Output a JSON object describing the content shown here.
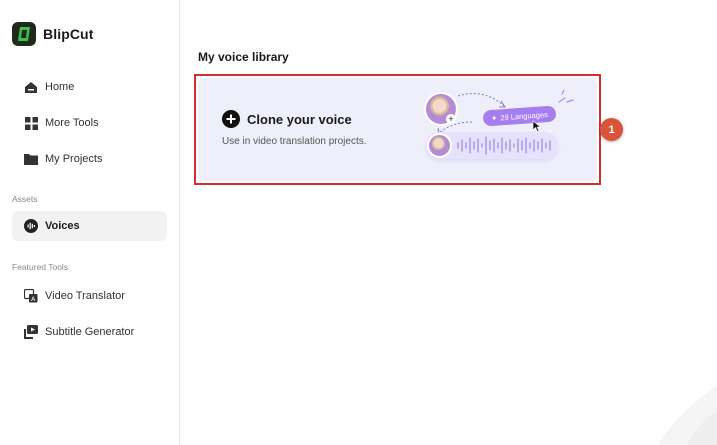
{
  "brand": {
    "name": "BlipCut",
    "logo_color": "#1f2a1c",
    "accent_color": "#3ec04b"
  },
  "nav": {
    "items": [
      {
        "label": "Home",
        "icon": "home-icon"
      },
      {
        "label": "More Tools",
        "icon": "grid-icon"
      },
      {
        "label": "My Projects",
        "icon": "folder-icon"
      }
    ],
    "assets_label": "Assets",
    "assets_items": [
      {
        "label": "Voices",
        "icon": "voice-icon",
        "active": true
      }
    ],
    "featured_label": "Featured Tools",
    "featured_items": [
      {
        "label": "Video Translator",
        "icon": "translate-icon"
      },
      {
        "label": "Subtitle Generator",
        "icon": "subtitle-icon"
      }
    ]
  },
  "main": {
    "title": "My voice library",
    "clone_card": {
      "title": "Clone your voice",
      "subtitle": "Use in video translation projects.",
      "languages_pill": "29 Languages",
      "background_color": "#efeffc"
    }
  },
  "annotation": {
    "badge_number": "1",
    "highlight_color": "#d62e2e",
    "badge_color": "#d9553a"
  }
}
